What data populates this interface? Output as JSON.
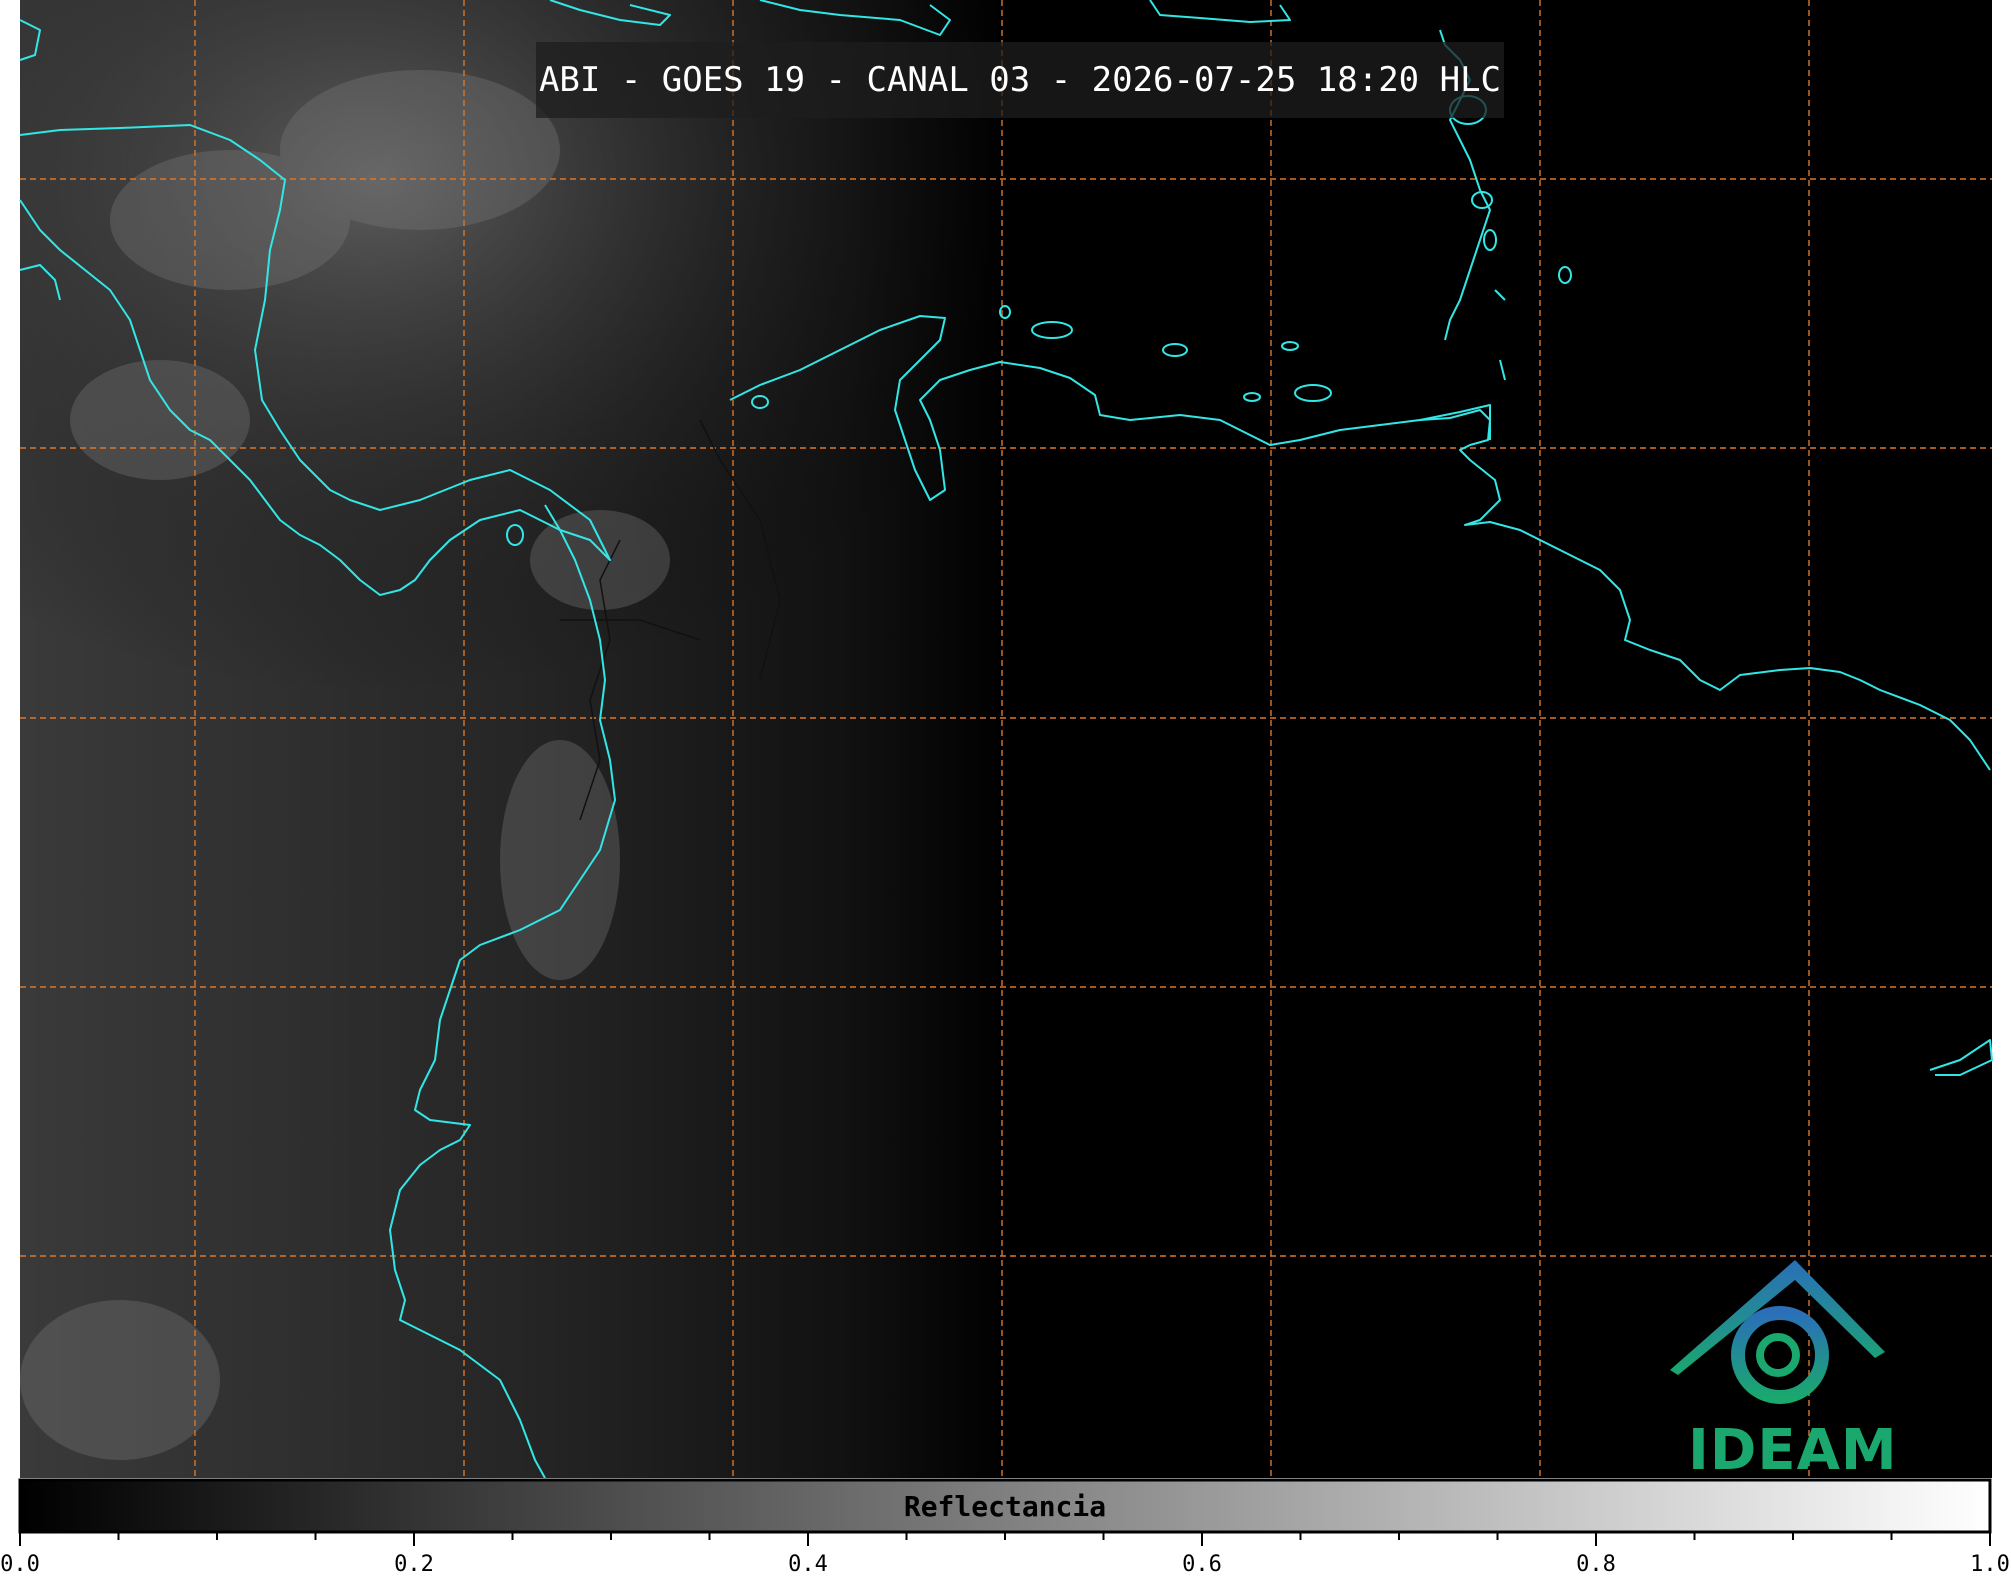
{
  "title": "ABI - GOES 19 - CANAL 03 - 2026-07-25 18:20 HLC",
  "colorbar": {
    "label": "Reflectancia",
    "min": 0.0,
    "max": 1.0,
    "major_ticks": [
      "0.0",
      "0.2",
      "0.4",
      "0.6",
      "0.8",
      "1.0"
    ],
    "minor_step": 0.05,
    "gradient": [
      "#000000",
      "#ffffff"
    ]
  },
  "logo": {
    "text": "IDEAM",
    "colors": [
      "#2a6fb8",
      "#1aa86e"
    ]
  },
  "colors": {
    "coastline": "#33e6e6",
    "gridlines": "#d9772a",
    "borders": "#111111",
    "background": "#000000"
  }
}
